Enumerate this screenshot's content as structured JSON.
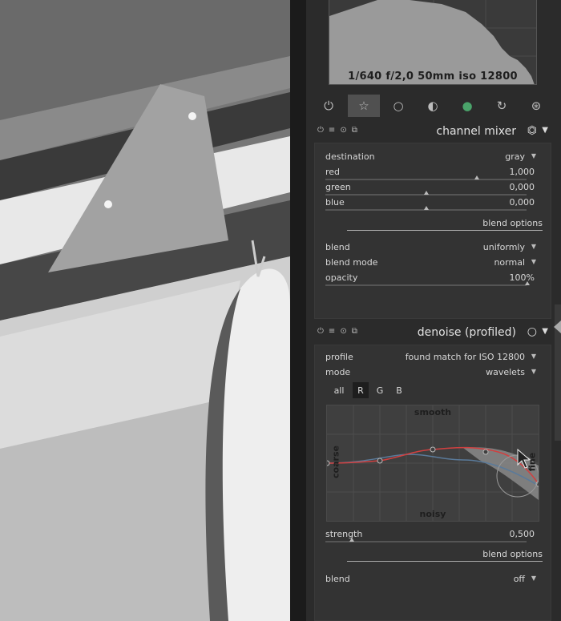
{
  "histogram": {
    "exif": "1/640 f/2,0 50mm iso 12800"
  },
  "groups": [
    {
      "icon": "power-icon",
      "glyph": "⏻"
    },
    {
      "icon": "star-icon",
      "glyph": "☆"
    },
    {
      "icon": "circle-icon",
      "glyph": "○"
    },
    {
      "icon": "tone-icon",
      "glyph": "◐"
    },
    {
      "icon": "color-icon",
      "glyph": "●"
    },
    {
      "icon": "correct-icon",
      "glyph": "↻"
    },
    {
      "icon": "effect-icon",
      "glyph": "⊛"
    }
  ],
  "channel_mixer": {
    "title": "channel mixer",
    "destination": {
      "label": "destination",
      "value": "gray"
    },
    "red": {
      "label": "red",
      "value": "1,000",
      "level": 0.95
    },
    "green": {
      "label": "green",
      "value": "0,000",
      "level": 0.5
    },
    "blue": {
      "label": "blue",
      "value": "0,000",
      "level": 0.5
    },
    "blend_options": "blend options",
    "blend": {
      "label": "blend",
      "value": "uniformly"
    },
    "blend_mode": {
      "label": "blend mode",
      "value": "normal"
    },
    "opacity": {
      "label": "opacity",
      "value": "100%",
      "level": 1.0
    }
  },
  "denoise": {
    "title": "denoise (profiled)",
    "profile": {
      "label": "profile",
      "value": "found match for ISO 12800"
    },
    "mode": {
      "label": "mode",
      "value": "wavelets"
    },
    "channels": [
      "all",
      "R",
      "G",
      "B"
    ],
    "active_channel": "R",
    "graph": {
      "top": "smooth",
      "bottom": "noisy",
      "left": "coarse",
      "right": "fine"
    },
    "strength": {
      "label": "strength",
      "value": "0,500",
      "level": 0.12
    },
    "blend_options": "blend options",
    "blend": {
      "label": "blend",
      "value": "off"
    }
  },
  "colors": {
    "accent_red": "#d04040",
    "accent_blue": "#5a7a9a"
  }
}
